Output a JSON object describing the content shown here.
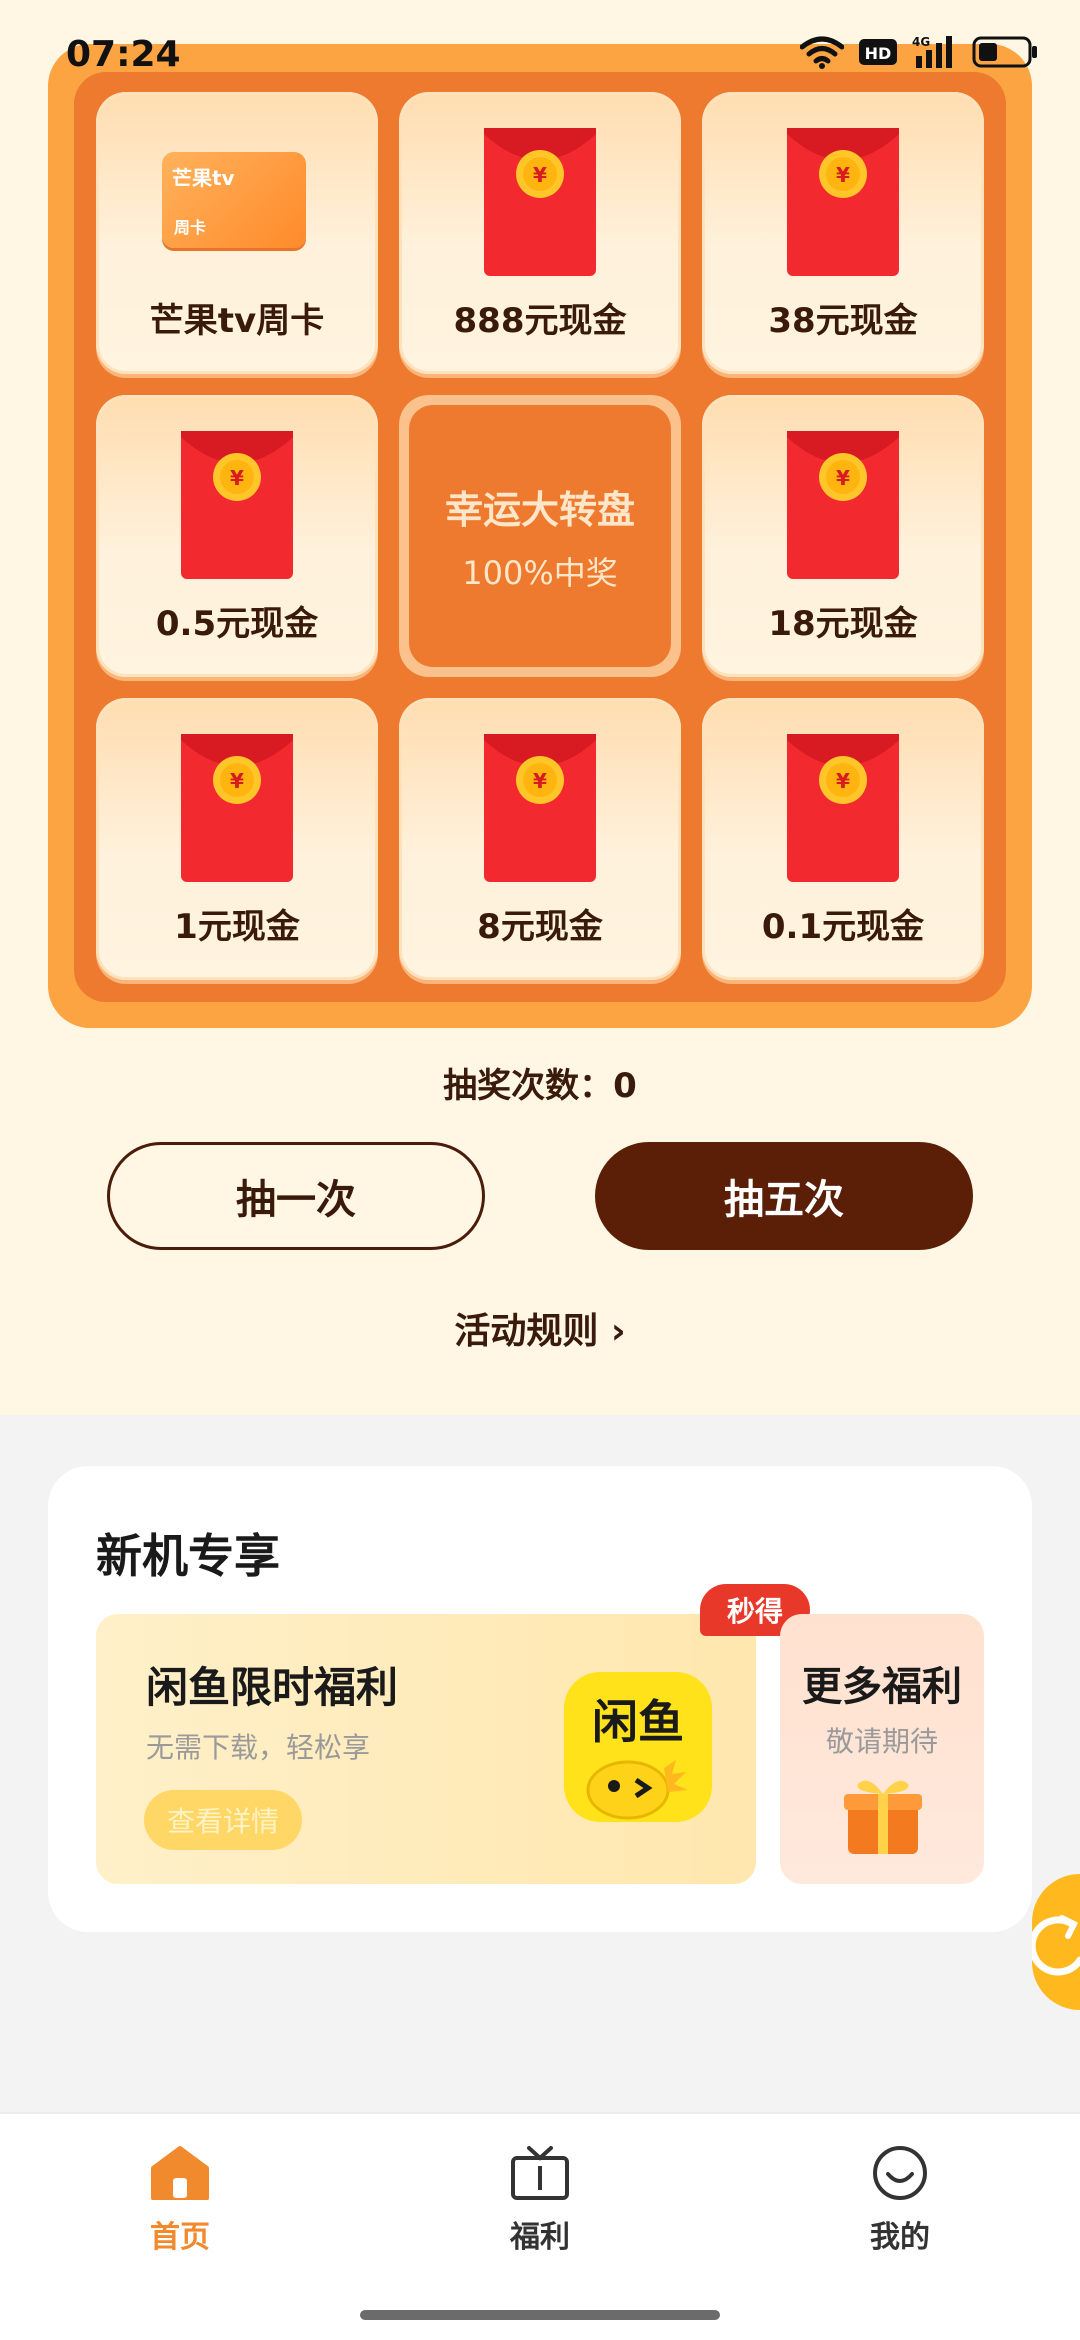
{
  "status_bar": {
    "time": "07:24",
    "icons": [
      "wifi-icon",
      "hd-icon",
      "signal-4g-icon",
      "battery-icon"
    ]
  },
  "lottery": {
    "prizes": [
      {
        "label": "芒果tv周卡",
        "type": "card",
        "card_logo": "芒果tv",
        "card_text": "周卡"
      },
      {
        "label": "888元现金",
        "type": "red-envelope"
      },
      {
        "label": "38元现金",
        "type": "red-envelope"
      },
      {
        "label": "0.5元现金",
        "type": "red-envelope"
      },
      {
        "label": "18元现金",
        "type": "red-envelope"
      },
      {
        "label": "1元现金",
        "type": "red-envelope"
      },
      {
        "label": "8元现金",
        "type": "red-envelope"
      },
      {
        "label": "0.1元现金",
        "type": "red-envelope"
      }
    ],
    "center": {
      "title": "幸运大转盘",
      "subtitle": "100%中奖"
    },
    "draw_count_label": "抽奖次数：0",
    "draw_once_label": "抽一次",
    "draw_five_label": "抽五次",
    "rules_label": "活动规则 ›"
  },
  "exclusive": {
    "title": "新机专享",
    "main_promo": {
      "title": "闲鱼限时福利",
      "subtitle": "无需下载，轻松享",
      "button_label": "查看详情",
      "badge": "秒得",
      "logo_text": "闲鱼"
    },
    "side_promo": {
      "title": "更多福利",
      "subtitle": "敬请期待"
    }
  },
  "bottom_nav": {
    "items": [
      {
        "label": "首页",
        "icon": "home-icon",
        "active": true
      },
      {
        "label": "福利",
        "icon": "tv-icon",
        "active": false
      },
      {
        "label": "我的",
        "icon": "smile-icon",
        "active": false
      }
    ]
  },
  "colors": {
    "accent": "#ee7a30",
    "board_outer": "#fca442",
    "active_nav": "#f08a2c",
    "dark_button": "#5b1f08",
    "envelope_red": "#f22a30",
    "coin_gold": "#ffc62a"
  }
}
